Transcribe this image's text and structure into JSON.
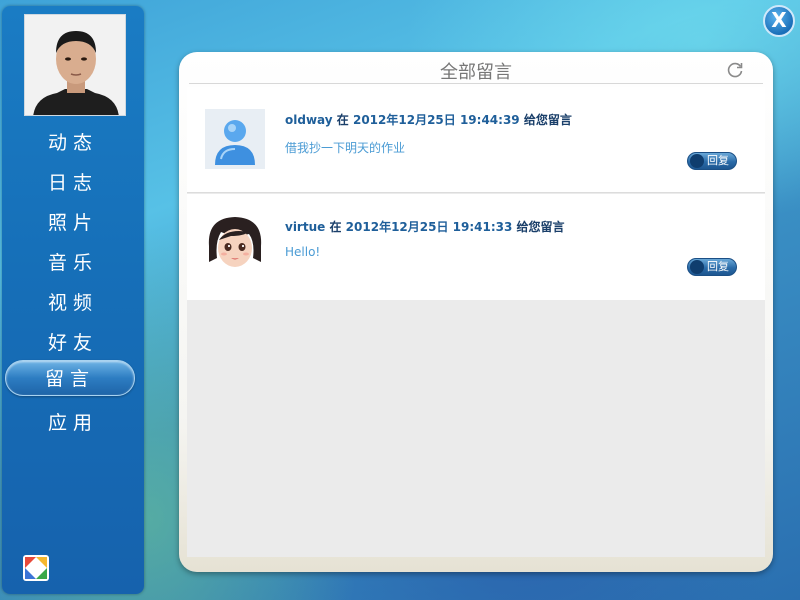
{
  "sidebar": {
    "avatar": "user-photo",
    "items": [
      {
        "label": "动态"
      },
      {
        "label": "日志"
      },
      {
        "label": "照片"
      },
      {
        "label": "音乐"
      },
      {
        "label": "视频"
      },
      {
        "label": "好友"
      },
      {
        "label": "留言",
        "active": true
      },
      {
        "label": "应用"
      }
    ]
  },
  "close": {
    "label": "X"
  },
  "panel": {
    "title": "全部留言",
    "refresh_icon": "refresh-icon"
  },
  "messages": [
    {
      "user": "oldway",
      "at": "在",
      "datetime": "2012年12月25日 19:44:39",
      "suffix": "给您留言",
      "text": "借我抄一下明天的作业",
      "avatar": "default-user-avatar",
      "reply_label": "回复"
    },
    {
      "user": "virtue",
      "at": "在",
      "datetime": "2012年12月25日 19:41:33",
      "suffix": "给您留言",
      "text": "Hello!",
      "avatar": "cartoon-girl-avatar",
      "reply_label": "回复"
    }
  ],
  "colors": {
    "sidebar": "#1a7cc4",
    "meta_text": "#1f5f9a",
    "message_text": "#4a9bd4"
  }
}
